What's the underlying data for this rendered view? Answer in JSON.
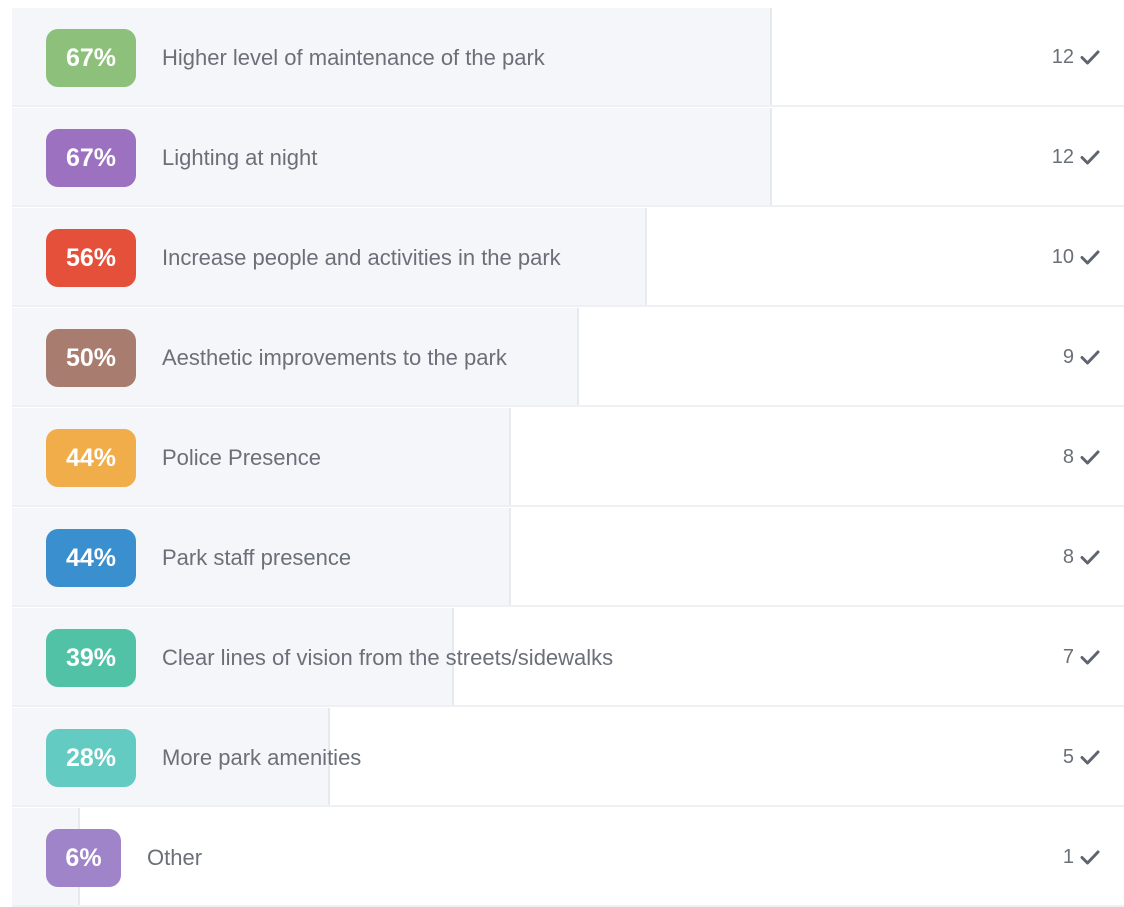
{
  "chart_data": {
    "type": "bar",
    "orientation": "horizontal",
    "value_max": 100,
    "rows": [
      {
        "label": "Higher level of maintenance of the park",
        "percent": 67,
        "percent_label": "67%",
        "count": "12",
        "color": "#8dc17b"
      },
      {
        "label": "Lighting at night",
        "percent": 67,
        "percent_label": "67%",
        "count": "12",
        "color": "#9b71c0"
      },
      {
        "label": "Increase people and activities in the park",
        "percent": 56,
        "percent_label": "56%",
        "count": "10",
        "color": "#e5503a"
      },
      {
        "label": "Aesthetic improvements to the park",
        "percent": 50,
        "percent_label": "50%",
        "count": "9",
        "color": "#a87c6e"
      },
      {
        "label": "Police Presence",
        "percent": 44,
        "percent_label": "44%",
        "count": "8",
        "color": "#f2ad4b"
      },
      {
        "label": "Park staff presence",
        "percent": 44,
        "percent_label": "44%",
        "count": "8",
        "color": "#3a8fce"
      },
      {
        "label": "Clear lines of vision from the streets/sidewalks",
        "percent": 39,
        "percent_label": "39%",
        "count": "7",
        "color": "#52c2a6"
      },
      {
        "label": "More park amenities",
        "percent": 28,
        "percent_label": "28%",
        "count": "5",
        "color": "#64cbc2"
      },
      {
        "label": "Other",
        "percent": 6,
        "percent_label": "6%",
        "count": "1",
        "color": "#9f84c9"
      }
    ]
  },
  "icons": {
    "count_icon": "checkmark-icon"
  }
}
